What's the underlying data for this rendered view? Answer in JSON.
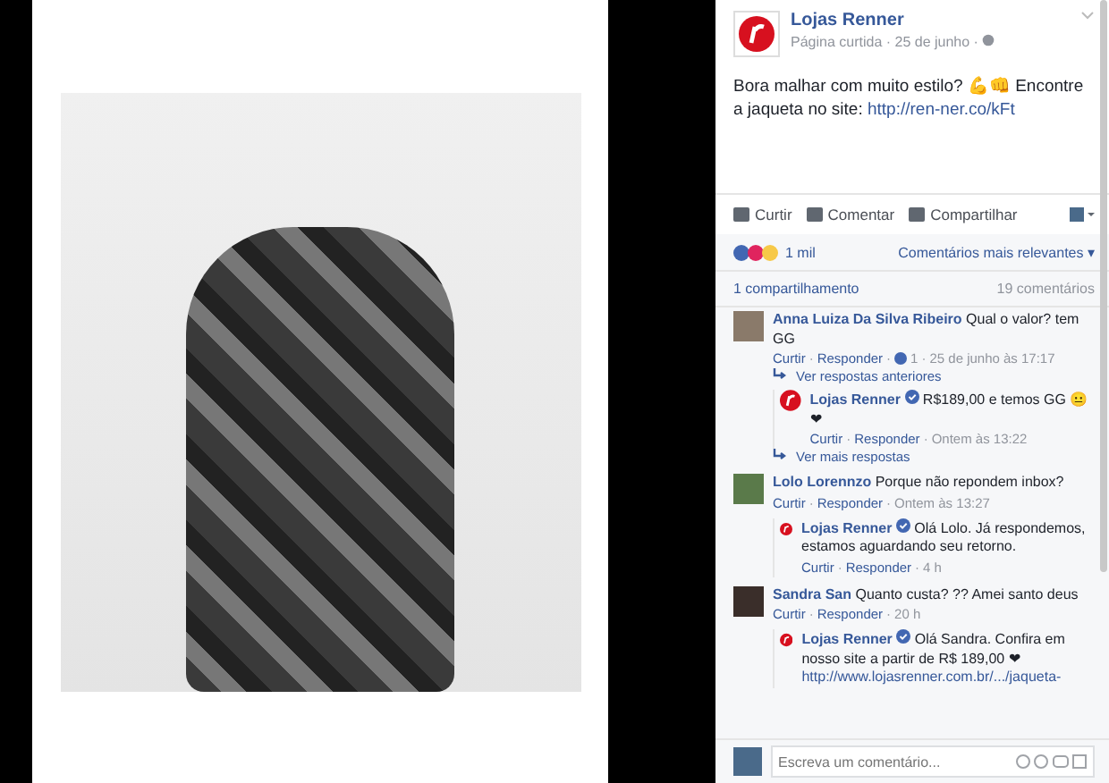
{
  "post": {
    "page_name": "Lojas Renner",
    "meta": "Página curtida · 25 de junho ·",
    "text": "Bora malhar com muito estilo? 💪👊 Encontre a jaqueta no site:",
    "link": "http://ren-ner.co/kFt"
  },
  "actions": [
    "Curtir",
    "Comentar",
    "Compartilhar"
  ],
  "reactions": {
    "count": "1 mil",
    "sort": "Comentários mais relevantes",
    "sort_caret": "▾"
  },
  "stats": {
    "shares": "1 compartilhamento",
    "comments": "19 comentários"
  },
  "separator": "·",
  "comments": [
    {
      "author": "Anna Luiza Da Silva Ribeiro",
      "text": "Qual o valor? tem GG",
      "like": "Curtir",
      "reply": "Responder",
      "likes": "1",
      "time": "25 de junho às 17:17",
      "more_before": "Ver respostas anteriores",
      "replies": [
        {
          "author": "Lojas Renner",
          "text": "R$189,00 e temos GG 😐❤",
          "like": "Curtir",
          "reply": "Responder",
          "time": "Ontem às 13:22"
        }
      ],
      "more_after": "Ver mais respostas"
    },
    {
      "author": "Lolo Lorennzo",
      "text": "Porque não repondem inbox?",
      "like": "Curtir",
      "reply": "Responder",
      "time": "Ontem às 13:27",
      "replies": [
        {
          "author": "Lojas Renner",
          "text": "Olá Lolo. Já respondemos, estamos aguardando seu retorno.",
          "like": "Curtir",
          "reply": "Responder",
          "time": "4 h"
        }
      ]
    },
    {
      "author": "Sandra San",
      "text": "Quanto custa? ?? Amei santo deus",
      "like": "Curtir",
      "reply": "Responder",
      "time": "20 h",
      "replies": [
        {
          "author": "Lojas Renner",
          "text": "Olá Sandra. Confira em nosso site a partir de R$ 189,00 ❤",
          "link": "http://www.lojasrenner.com.br/.../jaqueta-"
        }
      ]
    }
  ],
  "composer": {
    "placeholder": "Escreva um comentário..."
  }
}
